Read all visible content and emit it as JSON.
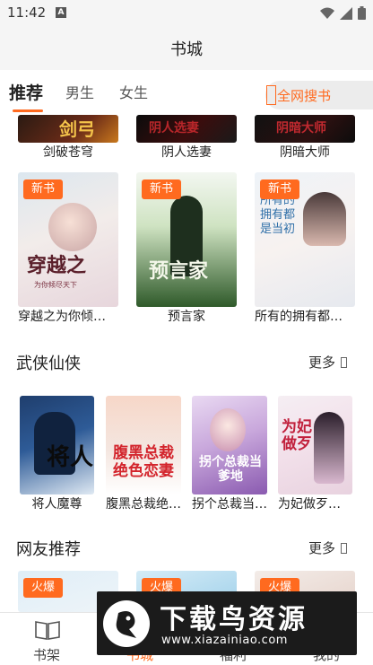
{
  "status_bar": {
    "time": "11:42",
    "notification_letter": "A"
  },
  "header": {
    "title": "书城"
  },
  "tabs": [
    {
      "label": "推荐",
      "active": true
    },
    {
      "label": "男生",
      "active": false
    },
    {
      "label": "女生",
      "active": false
    }
  ],
  "search": {
    "label": "全网搜书"
  },
  "top_row": [
    {
      "title": "剑破苍穹",
      "cover_text": "剑弓"
    },
    {
      "title": "阴人选妻",
      "cover_text": "阴人选妻"
    },
    {
      "title": "阴暗大师",
      "cover_text": "阴暗大师"
    }
  ],
  "new_books": {
    "badge": "新书",
    "items": [
      {
        "title": "穿越之为你倾…",
        "cover_text": "穿越之",
        "cover_sub": "为你倾尽天下"
      },
      {
        "title": "预言家",
        "cover_text": "预言家",
        "cover_sub": ""
      },
      {
        "title": "所有的拥有都…",
        "cover_text": "所有的拥有都是当初",
        "cover_sub": ""
      }
    ]
  },
  "section_wuxia": {
    "title": "武侠仙侠",
    "more": "更多",
    "items": [
      {
        "title": "将人魔尊",
        "cover_text": "将人"
      },
      {
        "title": "腹黑总裁绝色恋妻：萌宝…",
        "cover_text": "腹黑总裁绝色恋妻"
      },
      {
        "title": "拐个总裁当爹地",
        "cover_text": "拐个总裁当爹地"
      },
      {
        "title": "为妃做歹：王爷不过如此",
        "cover_text": "为妃做歹"
      }
    ]
  },
  "section_recommend": {
    "title": "网友推荐",
    "more": "更多",
    "badge": "火爆"
  },
  "bottom_nav": [
    {
      "label": "书架",
      "icon": "book-open-icon",
      "active": false
    },
    {
      "label": "书城",
      "icon": "store-icon",
      "active": true
    },
    {
      "label": "福利",
      "icon": "gift-icon",
      "active": false
    },
    {
      "label": "我的",
      "icon": "user-icon",
      "active": false
    }
  ],
  "watermark": {
    "text": "下载鸟资源",
    "url": "www.xiazainiao.com"
  },
  "colors": {
    "accent": "#ff6a1f",
    "background": "#ffffff",
    "bar": "#f5f5f5"
  }
}
